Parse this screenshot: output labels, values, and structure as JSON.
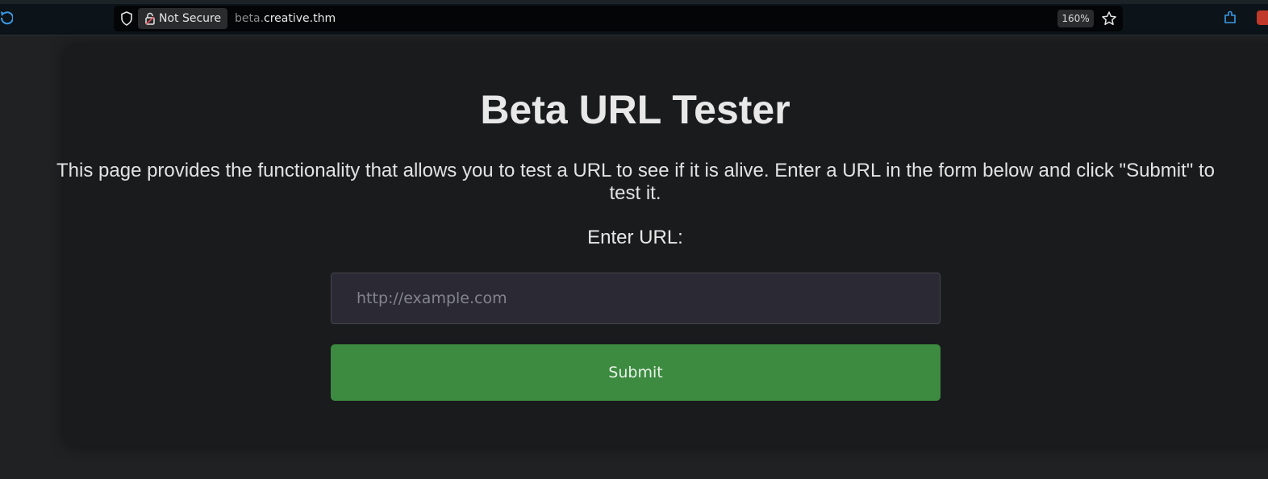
{
  "browser": {
    "security_label": "Not Secure",
    "url_subdomain": "beta.",
    "url_domain": "creative.thm",
    "zoom": "160%"
  },
  "icons": {
    "reload": "reload-icon",
    "shield": "shield-icon",
    "lock": "lock-icon",
    "star": "star-icon",
    "extensions": "extensions-icon",
    "addon": "addon-icon"
  },
  "page": {
    "title": "Beta URL Tester",
    "description_line1": "This page provides the functionality that allows you to test a URL to see if it is alive. Enter a URL in the form below and click \"Submit\" to",
    "description_line2": "test it.",
    "url_label": "Enter URL:",
    "url_placeholder": "http://example.com",
    "submit_label": "Submit"
  },
  "colors": {
    "submit_button": "#3c8b40",
    "card_background": "#1a1b1d",
    "input_background": "#2b2a34"
  }
}
